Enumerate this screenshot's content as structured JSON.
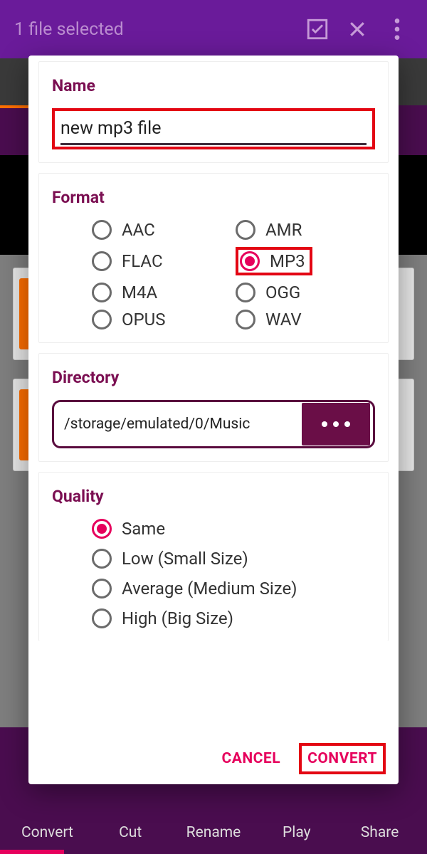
{
  "appbar": {
    "title": "1 file selected"
  },
  "bottom_tabs": [
    "Convert",
    "Cut",
    "Rename",
    "Play",
    "Share"
  ],
  "dialog": {
    "name": {
      "title": "Name",
      "value": "new mp3 file"
    },
    "format": {
      "title": "Format",
      "options": [
        "AAC",
        "AMR",
        "FLAC",
        "MP3",
        "M4A",
        "OGG",
        "OPUS",
        "WAV"
      ],
      "selected": "MP3"
    },
    "directory": {
      "title": "Directory",
      "path": "/storage/emulated/0/Music"
    },
    "quality": {
      "title": "Quality",
      "options": [
        "Same",
        "Low (Small Size)",
        "Average (Medium Size)",
        "High (Big Size)"
      ],
      "selected": "Same"
    },
    "actions": {
      "cancel": "CANCEL",
      "convert": "CONVERT"
    }
  }
}
